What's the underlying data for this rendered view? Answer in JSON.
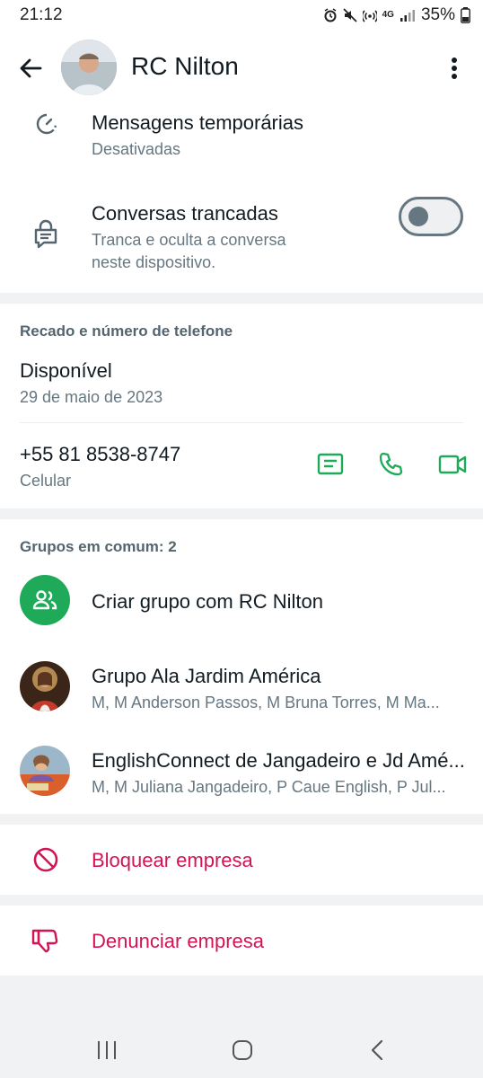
{
  "status_bar": {
    "time": "21:12",
    "battery": "35%",
    "network": "4G"
  },
  "header": {
    "contact_name": "RC Nilton"
  },
  "disappearing": {
    "title": "Mensagens temporárias",
    "status": "Desativadas"
  },
  "locked_chats": {
    "title": "Conversas trancadas",
    "description_line1": "Tranca e oculta a conversa",
    "description_line2": "neste dispositivo."
  },
  "about_section": {
    "header": "Recado e número de telefone",
    "about_text": "Disponível",
    "about_date": "29 de maio de 2023",
    "phone": "+55 81 8538-8747",
    "phone_type": "Celular"
  },
  "groups_section": {
    "header": "Grupos em comum: 2",
    "create_group_label": "Criar grupo com RC Nilton",
    "groups": [
      {
        "name": "Grupo Ala Jardim América",
        "members": "M, M Anderson Passos, M Bruna Torres, M Ma..."
      },
      {
        "name": "EnglishConnect de Jangadeiro e Jd Amé...",
        "members": "M, M Juliana Jangadeiro, P Caue English, P Jul..."
      }
    ]
  },
  "actions": {
    "block_label": "Bloquear empresa",
    "report_label": "Denunciar empresa"
  },
  "colors": {
    "accent": "#1faa59",
    "danger": "#d21552",
    "background": "#f1f2f4"
  }
}
